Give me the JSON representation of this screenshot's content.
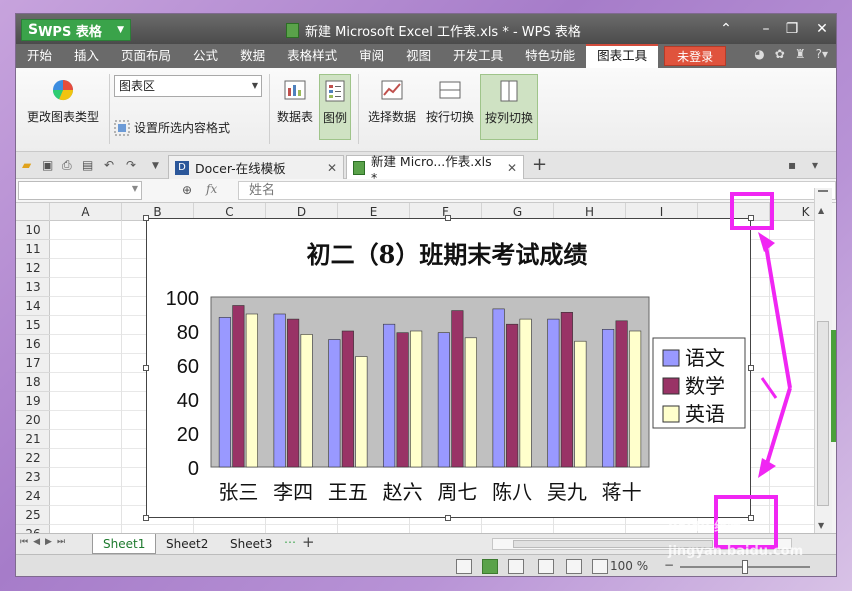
{
  "window": {
    "app_button": "WPS 表格",
    "app_logo": "S",
    "title": "新建 Microsoft Excel 工作表.xls * - WPS 表格"
  },
  "menu": {
    "items": [
      "开始",
      "插入",
      "页面布局",
      "公式",
      "数据",
      "表格样式",
      "审阅",
      "视图",
      "开发工具",
      "特色功能",
      "图表工具"
    ],
    "active": "图表工具",
    "login": "未登录"
  },
  "ribbon": {
    "change_type": "更改图表类型",
    "element_select": "图表区",
    "format_selection": "设置所选内容格式",
    "data_table": "数据表",
    "legend": "图例",
    "select_data": "选择数据",
    "switch_row": "按行切换",
    "switch_col": "按列切换"
  },
  "tabs": {
    "docer": "Docer-在线模板",
    "workbook": "新建 Micro...作表.xls *",
    "add": "+"
  },
  "formula_bar": {
    "fx": "fx",
    "content": "姓名"
  },
  "grid": {
    "columns": [
      "A",
      "B",
      "C",
      "D",
      "E",
      "F",
      "G",
      "H",
      "I",
      "K"
    ],
    "rows": [
      "10",
      "11",
      "12",
      "13",
      "14",
      "15",
      "16",
      "17",
      "18",
      "19",
      "20",
      "21",
      "22",
      "23",
      "24",
      "25",
      "26"
    ]
  },
  "chart_data": {
    "type": "bar",
    "title": "初二（8）班期末考试成绩",
    "categories": [
      "张三",
      "李四",
      "王五",
      "赵六",
      "周七",
      "陈八",
      "吴九",
      "蒋十"
    ],
    "series": [
      {
        "name": "语文",
        "values": [
          88,
          90,
          75,
          84,
          79,
          93,
          87,
          81
        ],
        "color": "#9999ff"
      },
      {
        "name": "数学",
        "values": [
          95,
          87,
          80,
          79,
          92,
          84,
          91,
          86
        ],
        "color": "#993366"
      },
      {
        "name": "英语",
        "values": [
          90,
          78,
          65,
          80,
          76,
          87,
          74,
          80
        ],
        "color": "#ffffcc"
      }
    ],
    "yticks": [
      "0",
      "20",
      "40",
      "60",
      "80",
      "100"
    ],
    "ylim": [
      0,
      100
    ],
    "plot_bg": "#c0c0c0",
    "legend_position": "right",
    "grid": false
  },
  "sheets": {
    "tabs": [
      "Sheet1",
      "Sheet2",
      "Sheet3"
    ],
    "active": "Sheet1",
    "add": "+"
  },
  "status": {
    "zoom": "100 %",
    "zoom_minus": "−"
  },
  "colors": {
    "accent_green": "#3aa34a",
    "login_red": "#e0533d",
    "annotation_magenta": "#f026f3"
  },
  "watermark": "Baidu 经验 jingyan.baidu.com"
}
